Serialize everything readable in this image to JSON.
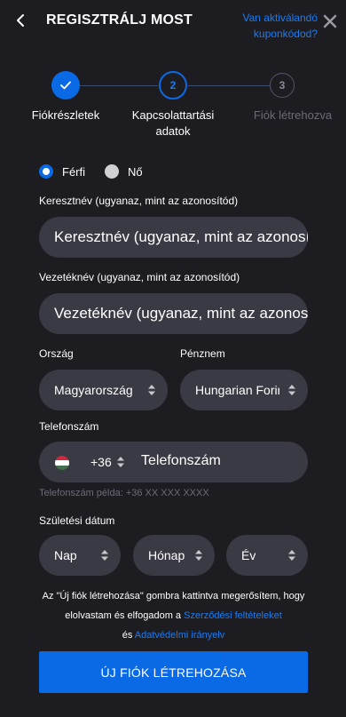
{
  "header": {
    "title": "REGISZTRÁLJ MOST",
    "coupon_link": "Van aktiválandó kuponkódod?"
  },
  "stepper": {
    "steps": [
      {
        "number": "",
        "label": "Fiókrészletek",
        "state": "completed"
      },
      {
        "number": "2",
        "label": "Kapcsolattartási adatok",
        "state": "active"
      },
      {
        "number": "3",
        "label": "Fiók létrehozva",
        "state": "upcoming"
      }
    ]
  },
  "gender": {
    "options": [
      {
        "label": "Férfi",
        "selected": true
      },
      {
        "label": "Nő",
        "selected": false
      }
    ]
  },
  "first_name": {
    "label": "Keresztnév (ugyanaz, mint az azonosítód)",
    "placeholder": "Keresztnév (ugyanaz, mint az azonosítód)"
  },
  "last_name": {
    "label": "Vezetéknév (ugyanaz, mint az azonosítód)",
    "placeholder": "Vezetéknév (ugyanaz, mint az azonosítód)"
  },
  "country": {
    "label": "Ország",
    "value": "Magyarország"
  },
  "currency": {
    "label": "Pénznem",
    "value": "Hungarian Forint"
  },
  "phone": {
    "label": "Telefonszám",
    "prefix": "+36",
    "placeholder": "Telefonszám",
    "hint": "Telefonszám példa: +36 XX XXX XXXX"
  },
  "birthdate": {
    "label": "Születési dátum",
    "day": "Nap",
    "month": "Hónap",
    "year": "Év"
  },
  "terms": {
    "text_1": "Az \"Új fiók létrehozása\" gombra kattintva megerősítem, hogy elolvastam és elfogadom a",
    "link_1": "Szerződési feltételeket",
    "text_2": "és",
    "link_2": "Adatvédelmi irányelv"
  },
  "submit_label": "ÚJ FIÓK LÉTREHOZÁSA",
  "colors": {
    "accent": "#0a6ae6",
    "link": "#1e7bf0",
    "background": "#1c1c21",
    "field": "#3a3a44"
  }
}
